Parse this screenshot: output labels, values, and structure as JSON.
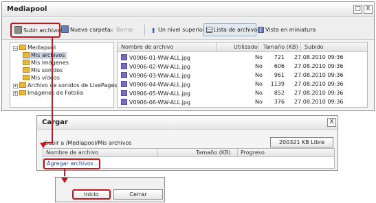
{
  "mediapool": {
    "title": "Mediapool",
    "maximize_symbol": "□",
    "close_symbol": "X",
    "toolbar": {
      "upload_label": "Subir archivos",
      "new_folder_label": "Nueva carpeta",
      "delete_label": "Borrar",
      "up_level_label": "Un nivel superior",
      "file_list_label": "Lista de archivos",
      "thumbnail_label": "Vista en miniatura"
    },
    "tree": [
      {
        "label": "Mediapool",
        "toggle": "−"
      },
      {
        "label": "Mis archivos",
        "toggle": ""
      },
      {
        "label": "Mis imágenes",
        "toggle": ""
      },
      {
        "label": "Mis sonidos",
        "toggle": ""
      },
      {
        "label": "Mis vídeos",
        "toggle": ""
      },
      {
        "label": "Archivo de sonidos de LivePages",
        "toggle": "+"
      },
      {
        "label": "Imágenes de Fotolia",
        "toggle": "+"
      }
    ],
    "columns": {
      "name": "Nombre de archivo",
      "used": "Utilizado",
      "size": "Tamaño (KB)",
      "uploaded": "Subido"
    },
    "files": [
      {
        "name": "V0906-01-WW-ALL.jpg",
        "used": "No",
        "size": "721",
        "uploaded": "27.08.2010 09:36"
      },
      {
        "name": "V0906-02-WW-ALL.jpg",
        "used": "No",
        "size": "606",
        "uploaded": "27.08.2010 09:36"
      },
      {
        "name": "V0906-03-WW-ALL.jpg",
        "used": "No",
        "size": "961",
        "uploaded": "27.08.2010 09:36"
      },
      {
        "name": "V0906-04-WW-ALL.jpg",
        "used": "No",
        "size": "1139",
        "uploaded": "27.08.2010 09:36"
      },
      {
        "name": "V0906-05-WW-ALL.jpg",
        "used": "No",
        "size": "852",
        "uploaded": "27.08.2010 09:36"
      },
      {
        "name": "V0906-06-WW-ALL.jpg",
        "used": "No",
        "size": "376",
        "uploaded": "27.08.2010 09:36"
      }
    ]
  },
  "cargar": {
    "title": "Cargar",
    "close_symbol": "X",
    "path": "Subir a /Mediapool/Mis archivos",
    "free_space": "200321 KB Libre",
    "columns": {
      "name": "Nombre de archivo",
      "size": "Tamaño (KB)",
      "progress": "Progreso"
    },
    "add_files_link": "Agregar archivos ..."
  },
  "buttons": {
    "start_label": "Inicio",
    "close_label": "Cerrar"
  },
  "colors": {
    "highlight": "#c4161c",
    "link": "#1a3fa8"
  }
}
